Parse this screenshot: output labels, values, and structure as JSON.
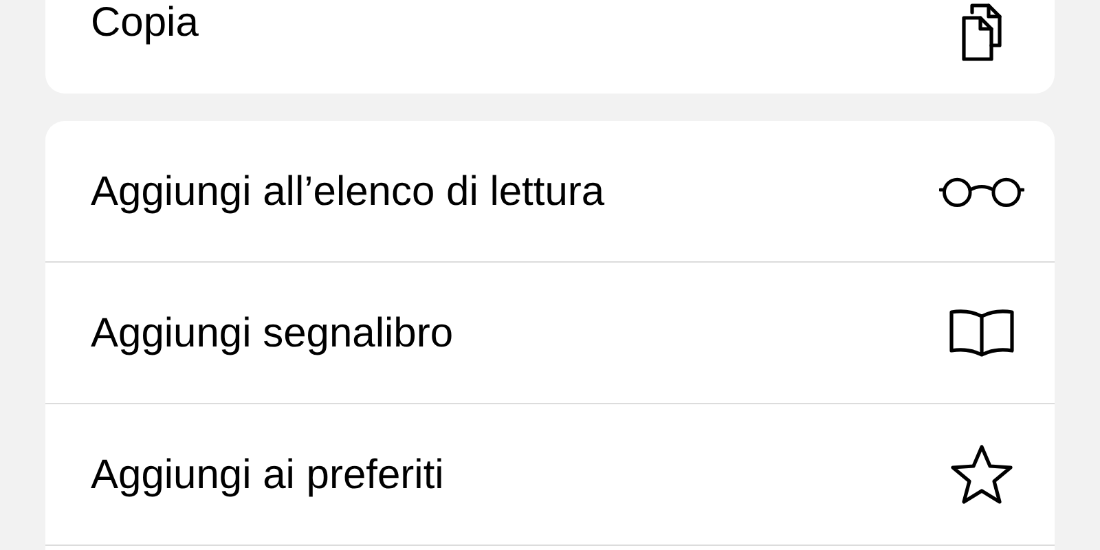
{
  "groups": [
    {
      "items": [
        {
          "label": "Copia",
          "kind": "copy"
        }
      ]
    },
    {
      "items": [
        {
          "label": "Aggiungi all’elenco di lettura",
          "kind": "glasses"
        },
        {
          "label": "Aggiungi segnalibro",
          "kind": "book"
        },
        {
          "label": "Aggiungi ai preferiti",
          "kind": "star"
        }
      ]
    }
  ]
}
